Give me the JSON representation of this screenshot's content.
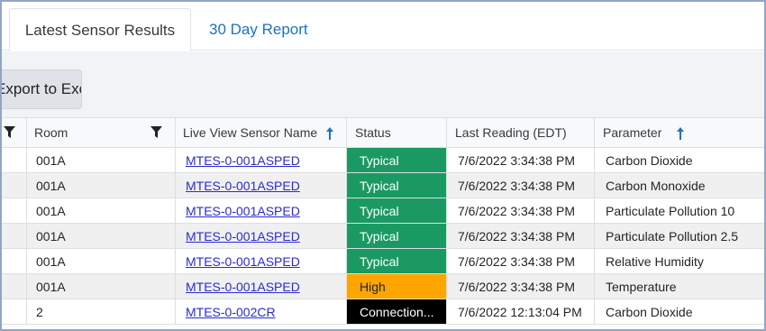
{
  "tabs": [
    {
      "label": "Latest Sensor Results",
      "active": true
    },
    {
      "label": "30 Day Report",
      "active": false
    }
  ],
  "toolbar": {
    "export_label": "Export to Excel"
  },
  "table": {
    "columns": {
      "room": "Room",
      "sensor_name": "Live View Sensor Name",
      "status": "Status",
      "last_reading": "Last Reading (EDT)",
      "parameter": "Parameter"
    },
    "rows": [
      {
        "room": "001A",
        "sensor": "MTES-0-001ASPED",
        "status": "Typical",
        "last_reading": "7/6/2022 3:34:38 PM",
        "parameter": "Carbon Dioxide"
      },
      {
        "room": "001A",
        "sensor": "MTES-0-001ASPED",
        "status": "Typical",
        "last_reading": "7/6/2022 3:34:38 PM",
        "parameter": "Carbon Monoxide"
      },
      {
        "room": "001A",
        "sensor": "MTES-0-001ASPED",
        "status": "Typical",
        "last_reading": "7/6/2022 3:34:38 PM",
        "parameter": "Particulate Pollution 10"
      },
      {
        "room": "001A",
        "sensor": "MTES-0-001ASPED",
        "status": "Typical",
        "last_reading": "7/6/2022 3:34:38 PM",
        "parameter": "Particulate Pollution 2.5"
      },
      {
        "room": "001A",
        "sensor": "MTES-0-001ASPED",
        "status": "Typical",
        "last_reading": "7/6/2022 3:34:38 PM",
        "parameter": "Relative Humidity"
      },
      {
        "room": "001A",
        "sensor": "MTES-0-001ASPED",
        "status": "High",
        "last_reading": "7/6/2022 3:34:38 PM",
        "parameter": "Temperature"
      },
      {
        "room": "2",
        "sensor": "MTES-0-002CR",
        "status": "Connection...",
        "last_reading": "7/6/2022 12:13:04 PM",
        "parameter": "Carbon Dioxide"
      }
    ]
  },
  "colors": {
    "typical": "#1a9a62",
    "high": "#ffa500",
    "connection": "#000000",
    "link": "#2a2ad6",
    "tab_link": "#1a73c8"
  },
  "icons": {
    "filter": "filter-icon",
    "sort": "sort-ascending-icon"
  }
}
